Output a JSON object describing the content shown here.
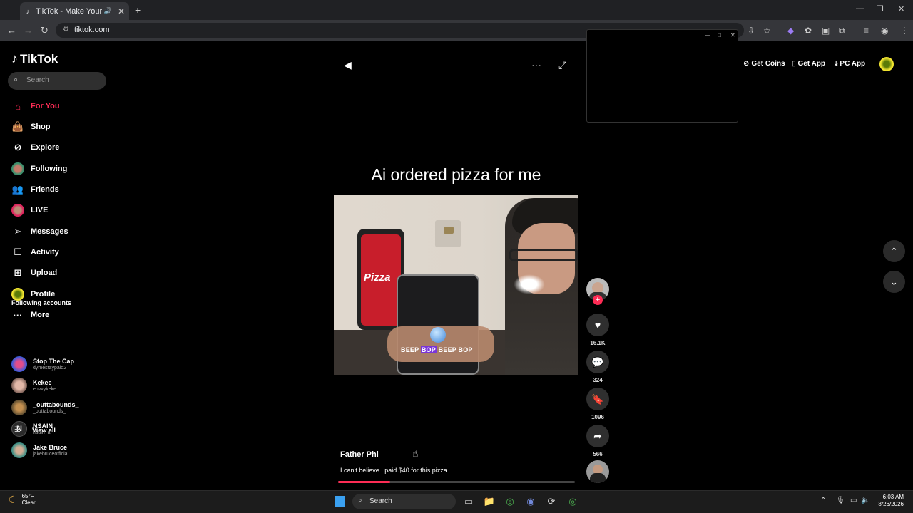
{
  "browser": {
    "tab_title": "TikTok - Make Your Day",
    "url": "tiktok.com"
  },
  "sidebar": {
    "logo": "TikTok",
    "search_placeholder": "Search",
    "items": [
      {
        "label": "For You",
        "icon": "home-icon",
        "active": true
      },
      {
        "label": "Shop",
        "icon": "shopping-bag-icon"
      },
      {
        "label": "Explore",
        "icon": "compass-icon"
      },
      {
        "label": "Following",
        "icon": "avatar"
      },
      {
        "label": "Friends",
        "icon": "friends-icon"
      },
      {
        "label": "LIVE",
        "icon": "avatar"
      },
      {
        "label": "Messages",
        "icon": "paper-plane-icon"
      },
      {
        "label": "Activity",
        "icon": "activity-icon"
      },
      {
        "label": "Upload",
        "icon": "plus-square-icon"
      },
      {
        "label": "Profile",
        "icon": "avatar"
      },
      {
        "label": "More",
        "icon": "more-dots-icon"
      }
    ],
    "following_title": "Following accounts",
    "accounts": [
      {
        "name": "Stop The Cap",
        "handle": "dymestaypaid2"
      },
      {
        "name": "Kekee",
        "handle": "envvykeke"
      },
      {
        "name": "_outtabounds_",
        "handle": "_outtabounds_"
      },
      {
        "name": "NSAIN",
        "handle": "nsain_ai"
      },
      {
        "name": "Jake Bruce",
        "handle": "jakebruceofficial"
      }
    ],
    "view_all": "View all"
  },
  "topbar": {
    "get_coins": "Get Coins",
    "get_app": "Get App",
    "pc_app": "PC App"
  },
  "video": {
    "title_overlay": "Ai ordered pizza for me",
    "caption_words": [
      "BEEP",
      "BOP",
      "BEEP",
      "BOP"
    ],
    "author": "Father Phi",
    "description": "I can't believe I paid $40 for this pizza",
    "progress": 0.22
  },
  "actions": {
    "likes": "16.1K",
    "comments": "324",
    "saves": "1096",
    "shares": "566"
  },
  "taskbar": {
    "weather_temp": "65°F",
    "weather_desc": "Clear",
    "search": "Search",
    "time": "6:03 AM",
    "date": "8/26/2026"
  },
  "colors": {
    "accent": "#fe2c55",
    "background": "#000000"
  }
}
